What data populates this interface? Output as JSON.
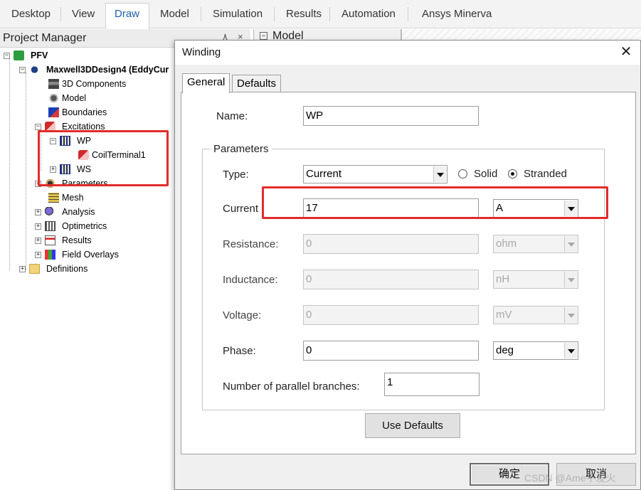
{
  "ribbon": {
    "tabs": [
      "Desktop",
      "View",
      "Draw",
      "Model",
      "Simulation",
      "Results",
      "Automation",
      "Ansys Minerva"
    ],
    "active_tab": "Draw"
  },
  "project_manager": {
    "title": "Project Manager",
    "pin_glyph": "٨",
    "close_glyph": "×",
    "tree": {
      "project": "PFV",
      "design": "Maxwell3DDesign4 (EddyCur",
      "items": [
        "3D Components",
        "Model",
        "Boundaries",
        "Excitations",
        "WP",
        "CoilTerminal1",
        "WS",
        "Parameters",
        "Mesh",
        "Analysis",
        "Optimetrics",
        "Results",
        "Field Overlays",
        "Definitions"
      ]
    }
  },
  "model_strip": {
    "label": "Model"
  },
  "dialog": {
    "title": "Winding",
    "close_glyph": "✕",
    "tabs": [
      "General",
      "Defaults"
    ],
    "name_label": "Name:",
    "name_value": "WP",
    "parameters_legend": "Parameters",
    "type_label": "Type:",
    "type_value": "Current",
    "radio_solid": "Solid",
    "radio_stranded": "Stranded",
    "radio_selected": "Stranded",
    "current_label": "Current",
    "current_value": "17",
    "current_unit": "A",
    "resistance_label": "Resistance:",
    "resistance_value": "0",
    "resistance_unit": "ohm",
    "inductance_label": "Inductance:",
    "inductance_value": "0",
    "inductance_unit": "nH",
    "voltage_label": "Voltage:",
    "voltage_value": "0",
    "voltage_unit": "mV",
    "phase_label": "Phase:",
    "phase_value": "0",
    "phase_unit": "deg",
    "branches_label": "Number of parallel branches:",
    "branches_value": "1",
    "use_defaults": "Use Defaults",
    "ok": "确定",
    "cancel": "取消"
  },
  "watermark": "CSDN @Ame不发火",
  "colors": {
    "annotation": "#e22b2b",
    "active_tab_text": "#1f5fae"
  }
}
